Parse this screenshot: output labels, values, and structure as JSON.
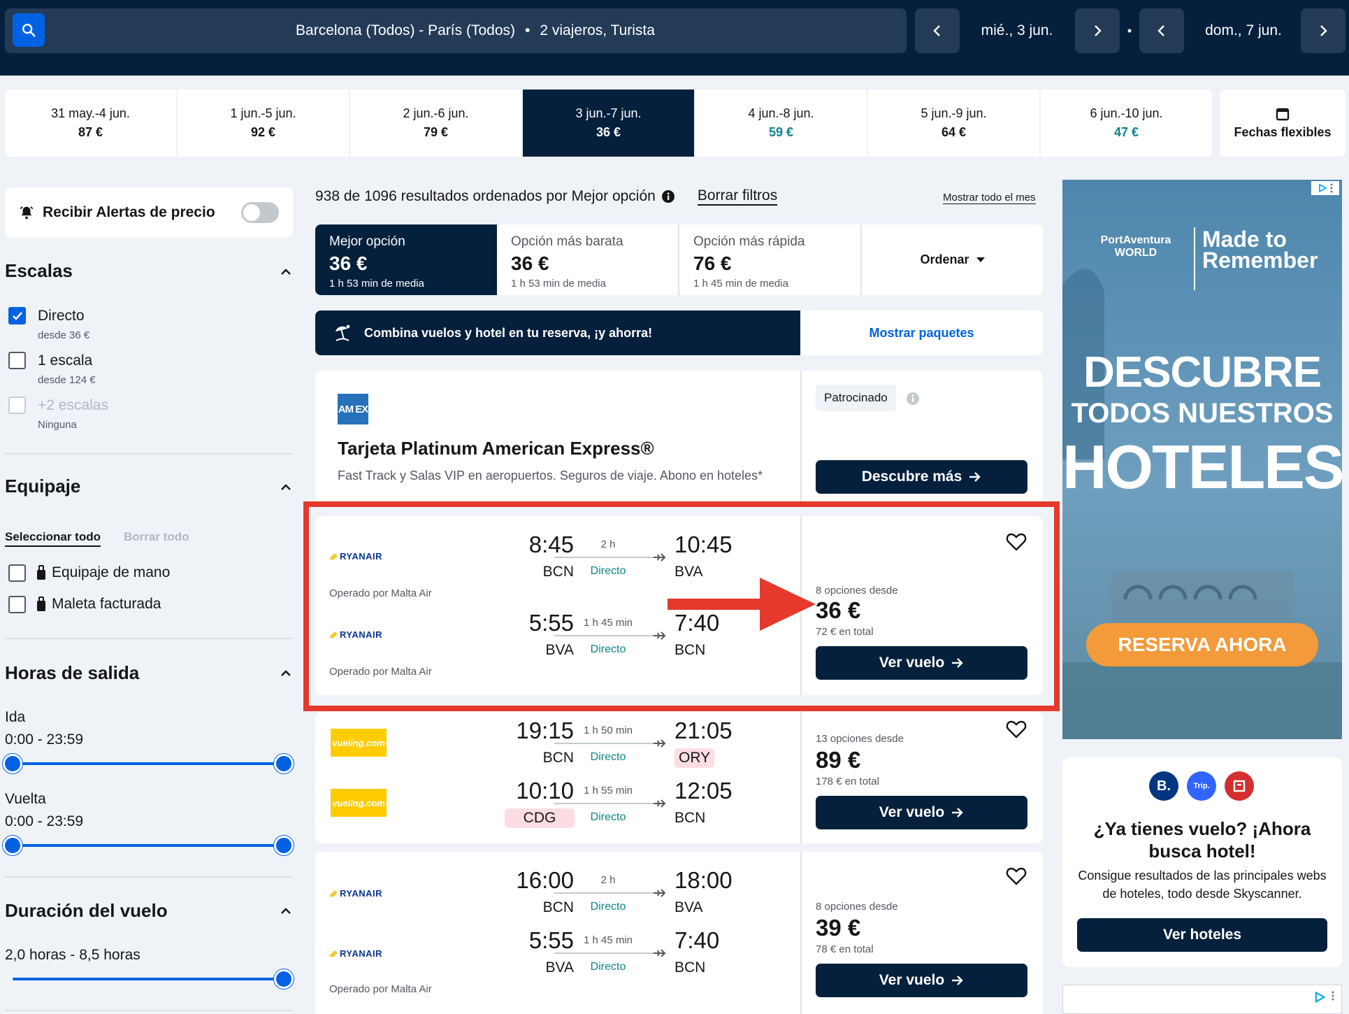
{
  "search": {
    "route": "Barcelona (Todos) - París (Todos)",
    "separator": "•",
    "travellers": "2 viajeros, Turista",
    "depart_date": "mié., 3 jun.",
    "return_date": "dom., 7 jun."
  },
  "date_tabs": [
    {
      "range": "31 may.-4 jun.",
      "price": "87 €"
    },
    {
      "range": "1 jun.-5 jun.",
      "price": "92 €"
    },
    {
      "range": "2 jun.-6 jun.",
      "price": "79 €"
    },
    {
      "range": "3 jun.-7 jun.",
      "price": "36 €",
      "selected": true
    },
    {
      "range": "4 jun.-8 jun.",
      "price": "59 €"
    },
    {
      "range": "5 jun.-9 jun.",
      "price": "64 €"
    },
    {
      "range": "6 jun.-10 jun.",
      "price": "47 €"
    }
  ],
  "flexible_dates": "Fechas flexibles",
  "sidebar": {
    "price_alerts": "Recibir Alertas de precio",
    "stops": {
      "title": "Escalas",
      "options": [
        {
          "label": "Directo",
          "sub": "desde 36 €",
          "checked": true
        },
        {
          "label": "1 escala",
          "sub": "desde 124 €",
          "checked": false
        },
        {
          "label": "+2 escalas",
          "sub": "Ninguna",
          "checked": false,
          "disabled": true
        }
      ]
    },
    "baggage": {
      "title": "Equipaje",
      "select_all": "Seleccionar todo",
      "clear_all": "Borrar todo",
      "options": [
        "Equipaje de mano",
        "Maleta facturada"
      ]
    },
    "departure_times": {
      "title": "Horas de salida",
      "outbound_label": "Ida",
      "outbound_range": "0:00 - 23:59",
      "return_label": "Vuelta",
      "return_range": "0:00 - 23:59"
    },
    "duration": {
      "title": "Duración del vuelo",
      "range": "2,0 horas - 8,5 horas"
    }
  },
  "results": {
    "summary": "938 de 1096 resultados ordenados por Mejor opción",
    "clear_filters": "Borrar filtros",
    "show_month": "Mostrar todo el mes",
    "sort_tabs": [
      {
        "label": "Mejor opción",
        "price": "36 €",
        "avg": "1 h 53 min de media"
      },
      {
        "label": "Opción más barata",
        "price": "36 €",
        "avg": "1 h 53 min de media"
      },
      {
        "label": "Opción más rápida",
        "price": "76 €",
        "avg": "1 h 45 min de media"
      }
    ],
    "order_label": "Ordenar",
    "combo_text": "Combina vuelos y hotel en tu reserva, ¡y ahorra!",
    "combo_link": "Mostrar paquetes"
  },
  "sponsored": {
    "logo": "AM EX",
    "title": "Tarjeta Platinum American Express®",
    "desc": "Fast Track y Salas VIP en aeropuertos. Seguros de viaje. Abono en hoteles*",
    "badge": "Patrocinado",
    "cta": "Descubre más"
  },
  "flights": [
    {
      "legs": [
        {
          "airline": "RYANAIR",
          "dep": "8:45",
          "dep_code": "BCN",
          "dur": "2 h",
          "type": "Directo",
          "arr": "10:45",
          "arr_code": "BVA",
          "operated": "Operado por Malta Air"
        },
        {
          "airline": "RYANAIR",
          "dep": "5:55",
          "dep_code": "BVA",
          "dur": "1 h 45 min",
          "type": "Directo",
          "arr": "7:40",
          "arr_code": "BCN",
          "operated": "Operado por Malta Air"
        }
      ],
      "options": "8 opciones desde",
      "price": "36 €",
      "total": "72 € en total",
      "cta": "Ver vuelo"
    },
    {
      "legs": [
        {
          "airline": "vueling.com",
          "dep": "19:15",
          "dep_code": "BCN",
          "dur": "1 h 50 min",
          "type": "Directo",
          "arr": "21:05",
          "arr_code": "ORY"
        },
        {
          "airline": "vueling.com",
          "dep": "10:10",
          "dep_code": "CDG",
          "dur": "1 h 55 min",
          "type": "Directo",
          "arr": "12:05",
          "arr_code": "BCN"
        }
      ],
      "options": "13 opciones desde",
      "price": "89 €",
      "total": "178 € en total",
      "cta": "Ver vuelo"
    },
    {
      "legs": [
        {
          "airline": "RYANAIR",
          "dep": "16:00",
          "dep_code": "BCN",
          "dur": "2 h",
          "type": "Directo",
          "arr": "18:00",
          "arr_code": "BVA"
        },
        {
          "airline": "RYANAIR",
          "dep": "5:55",
          "dep_code": "BVA",
          "dur": "1 h 45 min",
          "type": "Directo",
          "arr": "7:40",
          "arr_code": "BCN",
          "operated": "Operado por Malta Air"
        }
      ],
      "options": "8 opciones desde",
      "price": "39 €",
      "total": "78 € en total",
      "cta": "Ver vuelo"
    }
  ],
  "ads": {
    "brand": "PortAventura WORLD",
    "slogan": "Made to Remember",
    "line1": "DESCUBRE",
    "line2": "TODOS NUESTROS",
    "line3": "HOTELES",
    "cta": "RESERVA AHORA",
    "hotel_title": "¿Ya tienes vuelo? ¡Ahora busca hotel!",
    "hotel_desc": "Consigue resultados de las principales webs de hoteles, todo desde Skyscanner.",
    "hotel_cta": "Ver hoteles",
    "hotel_logos": [
      "B.",
      "Trip."
    ]
  },
  "colors": {
    "navy": "#05203c",
    "blue": "#0062e3",
    "teal": "#0c838a",
    "highlight_red": "#e5392c"
  }
}
